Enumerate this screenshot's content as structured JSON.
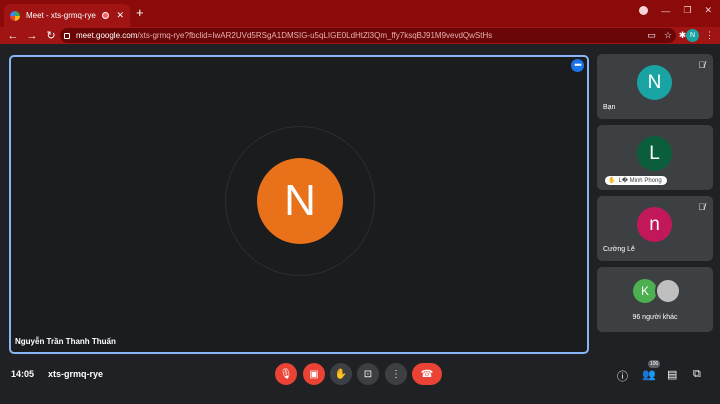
{
  "browser": {
    "tab_title": "Meet - xts-grmq-rye",
    "tab_close": "✕",
    "new_tab": "+",
    "url_host": "meet.google.com",
    "url_path": "/xts-grmq-rye?fbclid=IwAR2UVd5RSgA1DMSIG-u5qLIGE0LdHtZl3Qm_ffy7ksqBJ91M9vevdQwStHs",
    "profile_initial": "N",
    "accent_color": "#a01414"
  },
  "main_tile": {
    "initial": "N",
    "name": "Nguyễn Trần Thanh Thuấn",
    "avatar_color": "#e8711a"
  },
  "side_tiles": [
    {
      "initial": "N",
      "name": "Bạn",
      "avatar_color": "#1aa3a3",
      "muted": true
    },
    {
      "initial": "L",
      "name": "L� Minh Phong",
      "avatar_color": "#0b5e3b",
      "hand_raised": true
    },
    {
      "initial": "n",
      "name": "Cường Lê",
      "avatar_color": "#c2185b",
      "muted": true
    },
    {
      "initial": "K",
      "label": "96 người khác",
      "avatar_color": "#4caf50"
    }
  ],
  "bottom_bar": {
    "time": "14:05",
    "meeting_code": "xts-grmq-rye",
    "people_count": "100",
    "end_call_color": "#ea4335"
  }
}
